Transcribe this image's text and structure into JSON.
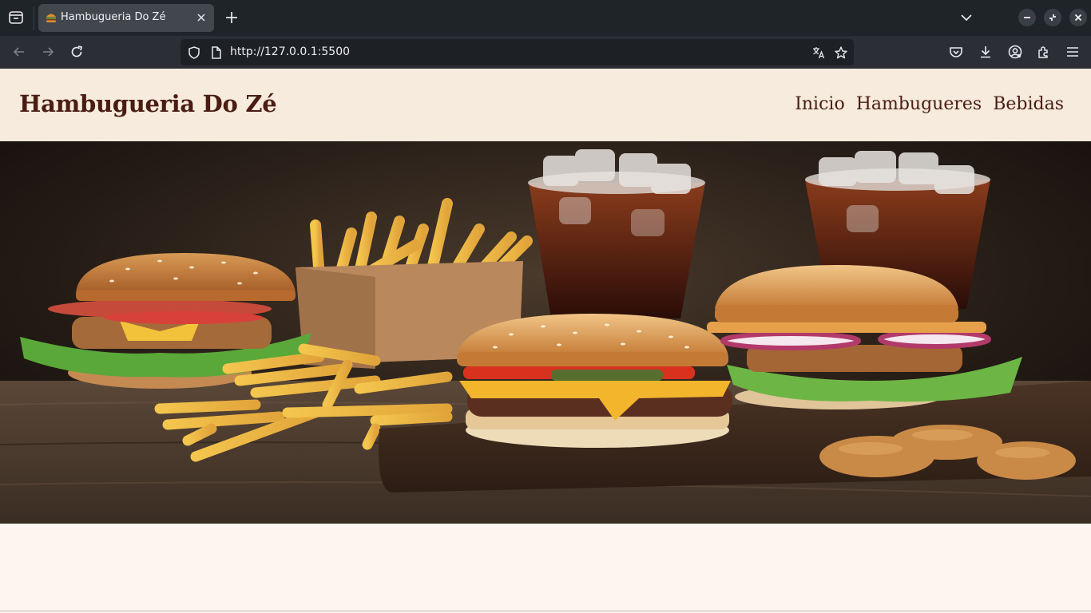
{
  "browser": {
    "tab": {
      "title": "Hambugueria Do Zé",
      "favicon": "burger-favicon"
    },
    "url": "http://127.0.0.1:5500",
    "icons": [
      "tab-overview-icon",
      "close-icon",
      "plus-icon",
      "chevron-down-icon",
      "minimize-icon",
      "restore-icon",
      "window-close-icon",
      "back-icon",
      "forward-icon",
      "reload-icon",
      "shield-icon",
      "page-icon",
      "translate-icon",
      "star-icon",
      "pocket-icon",
      "download-icon",
      "account-icon",
      "extensions-icon",
      "menu-icon"
    ]
  },
  "site": {
    "title": "Hambugueria Do Zé",
    "nav": [
      "Inicio",
      "Hambugueres",
      "Bebidas"
    ],
    "hero_image": "burgers-fries-and-sodas-photo",
    "colors": {
      "header_bg": "#f6ebdd",
      "title": "#4a1c12",
      "page_bg": "#fdf5ef"
    }
  }
}
